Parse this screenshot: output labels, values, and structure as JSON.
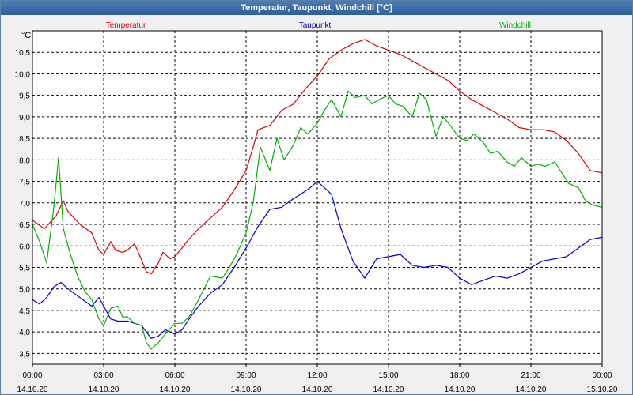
{
  "window": {
    "title": "Temperatur, Taupunkt, Windchill [°C]"
  },
  "colors": {
    "temperatur": "#e00000",
    "taupunkt": "#0000d0",
    "windchill": "#00b000",
    "grid": "#000000",
    "plot_bg": "#ffffff"
  },
  "chart_data": {
    "type": "line",
    "title": "Temperatur, Taupunkt, Windchill [°C]",
    "ylabel": "°C",
    "ylim": [
      3.25,
      11.0
    ],
    "yticks": [
      3.5,
      4.0,
      4.5,
      5.0,
      5.5,
      6.0,
      6.5,
      7.0,
      7.5,
      8.0,
      8.5,
      9.0,
      9.5,
      10.0,
      10.5
    ],
    "ytick_labels": [
      "3,5",
      "4,0",
      "4,5",
      "5,0",
      "5,5",
      "6,0",
      "6,5",
      "7,0",
      "7,5",
      "8,0",
      "8,5",
      "9,0",
      "9,5",
      "10,0",
      "10,5"
    ],
    "xlim": [
      0,
      24
    ],
    "xticks": [
      {
        "hour": 0,
        "time": "00:00",
        "date": "14.10.20"
      },
      {
        "hour": 3,
        "time": "03:00",
        "date": "14.10.20"
      },
      {
        "hour": 6,
        "time": "06:00",
        "date": "14.10.20"
      },
      {
        "hour": 9,
        "time": "09:00",
        "date": "14.10.20"
      },
      {
        "hour": 12,
        "time": "12:00",
        "date": "14.10.20"
      },
      {
        "hour": 15,
        "time": "15:00",
        "date": "14.10.20"
      },
      {
        "hour": 18,
        "time": "18:00",
        "date": "14.10.20"
      },
      {
        "hour": 21,
        "time": "21:00",
        "date": "14.10.20"
      },
      {
        "hour": 24,
        "time": "00:00",
        "date": "15.10.20"
      }
    ],
    "grid": true,
    "legend_placement": "top",
    "series": [
      {
        "name": "Temperatur",
        "color": "#e00000",
        "x": [
          0,
          0.5,
          1,
          1.3,
          1.5,
          2,
          2.5,
          2.8,
          3,
          3.3,
          3.5,
          3.8,
          4,
          4.3,
          4.5,
          4.8,
          5,
          5.3,
          5.5,
          5.8,
          6,
          6.3,
          6.5,
          7,
          7.5,
          8,
          8.5,
          9,
          9.3,
          9.5,
          10,
          10.5,
          11,
          11.5,
          12,
          12.5,
          13,
          13.5,
          14,
          14.5,
          15,
          15.5,
          16,
          16.5,
          17,
          17.5,
          18,
          18.5,
          19,
          19.5,
          20,
          20.5,
          21,
          21.5,
          22,
          22.5,
          23,
          23.5,
          24
        ],
        "values": [
          6.6,
          6.4,
          6.7,
          7.05,
          6.8,
          6.5,
          6.3,
          5.9,
          5.8,
          6.1,
          5.9,
          5.85,
          5.9,
          6.05,
          5.8,
          5.4,
          5.35,
          5.6,
          5.85,
          5.7,
          5.75,
          5.95,
          6.1,
          6.4,
          6.65,
          6.9,
          7.3,
          7.75,
          8.3,
          8.7,
          8.8,
          9.15,
          9.3,
          9.65,
          9.95,
          10.35,
          10.55,
          10.7,
          10.8,
          10.65,
          10.55,
          10.45,
          10.3,
          10.15,
          10.0,
          9.85,
          9.6,
          9.4,
          9.25,
          9.1,
          8.95,
          8.75,
          8.7,
          8.7,
          8.65,
          8.45,
          8.15,
          7.75,
          7.7
        ]
      },
      {
        "name": "Taupunkt",
        "color": "#0000d0",
        "x": [
          0,
          0.3,
          0.6,
          0.9,
          1.2,
          1.5,
          2,
          2.5,
          2.8,
          3,
          3.3,
          3.6,
          4,
          4.3,
          4.6,
          5,
          5.3,
          5.6,
          6,
          6.3,
          6.6,
          7,
          7.5,
          8,
          8.5,
          9,
          9.5,
          10,
          10.5,
          11,
          11.3,
          11.7,
          12,
          12.3,
          12.6,
          13,
          13.5,
          14,
          14.5,
          15,
          15.5,
          16,
          16.5,
          17,
          17.5,
          18,
          18.5,
          19,
          19.5,
          20,
          20.5,
          21,
          21.5,
          22,
          22.5,
          23,
          23.5,
          24
        ],
        "values": [
          4.75,
          4.65,
          4.8,
          5.05,
          5.15,
          5.0,
          4.8,
          4.6,
          4.8,
          4.6,
          4.3,
          4.25,
          4.25,
          4.2,
          4.15,
          3.85,
          3.9,
          4.05,
          3.95,
          4.05,
          4.3,
          4.6,
          4.9,
          5.1,
          5.5,
          5.95,
          6.45,
          6.85,
          6.9,
          7.1,
          7.2,
          7.35,
          7.5,
          7.35,
          7.2,
          6.4,
          5.65,
          5.25,
          5.7,
          5.75,
          5.8,
          5.55,
          5.5,
          5.55,
          5.5,
          5.25,
          5.1,
          5.2,
          5.3,
          5.25,
          5.35,
          5.5,
          5.65,
          5.7,
          5.75,
          5.95,
          6.15,
          6.2
        ]
      },
      {
        "name": "Windchill",
        "color": "#00b000",
        "x": [
          0,
          0.3,
          0.6,
          0.9,
          1.1,
          1.3,
          1.6,
          1.9,
          2.2,
          2.5,
          2.8,
          3,
          3.3,
          3.6,
          3.8,
          4,
          4.3,
          4.6,
          4.8,
          5,
          5.3,
          5.6,
          6,
          6.3,
          6.6,
          7,
          7.5,
          8,
          8.3,
          8.6,
          9,
          9.3,
          9.6,
          10,
          10.3,
          10.6,
          11,
          11.3,
          11.6,
          12,
          12.3,
          12.6,
          13,
          13.3,
          13.6,
          14,
          14.3,
          14.6,
          15,
          15.3,
          15.6,
          16,
          16.3,
          16.6,
          17,
          17.3,
          17.6,
          18,
          18.3,
          18.6,
          19,
          19.3,
          19.6,
          20,
          20.3,
          20.6,
          21,
          21.3,
          21.6,
          22,
          22.3,
          22.6,
          23,
          23.3,
          23.6,
          24
        ],
        "values": [
          6.5,
          6.1,
          5.6,
          6.9,
          8.05,
          6.4,
          5.8,
          5.3,
          4.95,
          4.75,
          4.3,
          4.15,
          4.55,
          4.6,
          4.35,
          4.35,
          4.2,
          4.15,
          3.75,
          3.6,
          3.75,
          3.95,
          4.2,
          4.2,
          4.35,
          4.75,
          5.3,
          5.25,
          5.5,
          5.8,
          6.3,
          7.0,
          8.3,
          7.75,
          8.5,
          8.0,
          8.35,
          8.75,
          8.6,
          8.85,
          9.15,
          9.4,
          9.0,
          9.6,
          9.45,
          9.5,
          9.3,
          9.4,
          9.5,
          9.3,
          9.25,
          9.0,
          9.55,
          9.4,
          8.55,
          9.0,
          8.8,
          8.5,
          8.45,
          8.6,
          8.4,
          8.15,
          8.2,
          7.95,
          7.85,
          8.05,
          7.85,
          7.9,
          7.85,
          7.95,
          7.7,
          7.45,
          7.35,
          7.05,
          6.95,
          6.9
        ]
      }
    ]
  }
}
